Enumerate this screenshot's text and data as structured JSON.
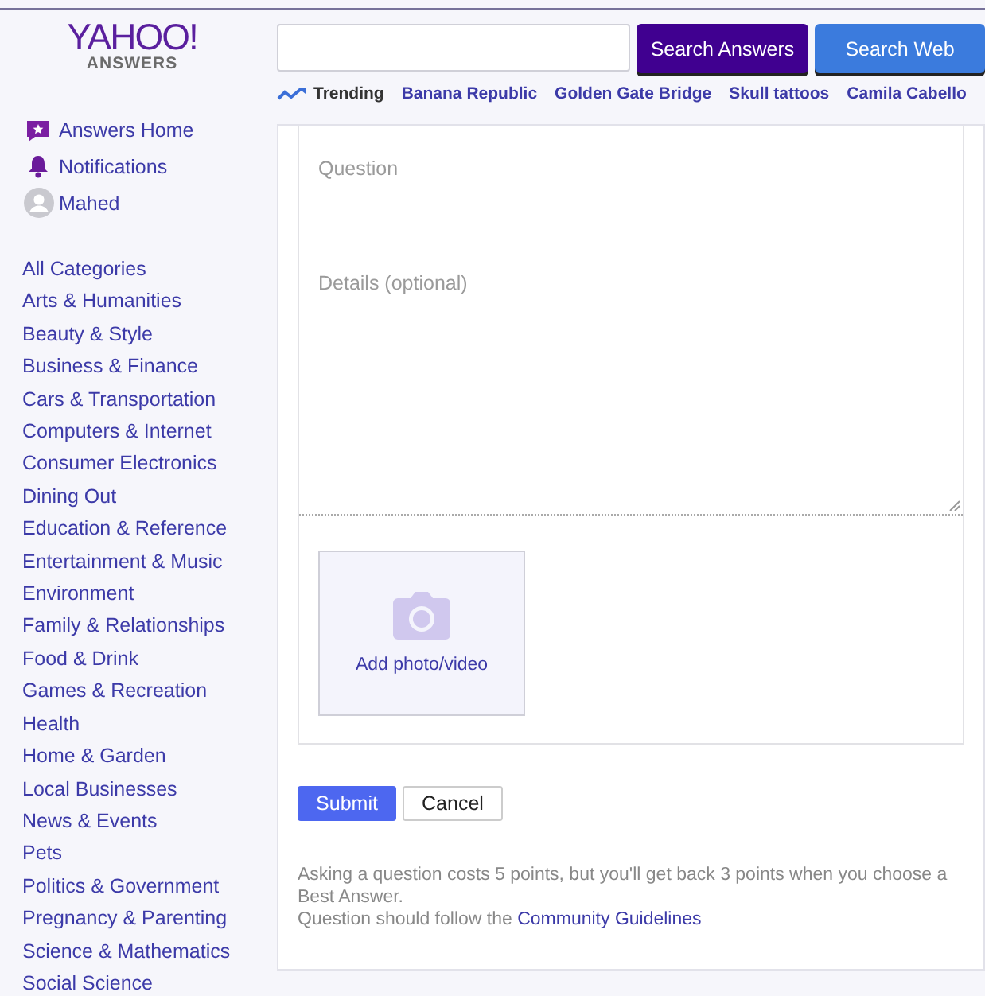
{
  "logo": {
    "brand": "YAHOO!",
    "product": "ANSWERS"
  },
  "nav": [
    {
      "kind": "home",
      "label": "Answers Home"
    },
    {
      "kind": "bell",
      "label": "Notifications"
    },
    {
      "kind": "avatar",
      "label": "Mahed"
    }
  ],
  "categories": [
    "All Categories",
    "Arts & Humanities",
    "Beauty & Style",
    "Business & Finance",
    "Cars & Transportation",
    "Computers & Internet",
    "Consumer Electronics",
    "Dining Out",
    "Education & Reference",
    "Entertainment & Music",
    "Environment",
    "Family & Relationships",
    "Food & Drink",
    "Games & Recreation",
    "Health",
    "Home & Garden",
    "Local Businesses",
    "News & Events",
    "Pets",
    "Politics & Government",
    "Pregnancy & Parenting",
    "Science & Mathematics",
    "Social Science"
  ],
  "search": {
    "buttons": [
      {
        "kind": "answers",
        "label": "Search Answers"
      },
      {
        "kind": "web",
        "label": "Search Web"
      }
    ]
  },
  "trending": {
    "label": "Trending",
    "topics": [
      "Banana Republic",
      "Golden Gate Bridge",
      "Skull tattoos",
      "Camila Cabello"
    ]
  },
  "form": {
    "question_placeholder": "Question",
    "details_placeholder": "Details (optional)",
    "add_media": "Add photo/video",
    "buttons": [
      {
        "kind": "primary",
        "label": "Submit"
      },
      {
        "kind": "secondary",
        "label": "Cancel"
      }
    ],
    "note": "Asking a question costs 5 points, but you'll get back 3 points when you choose a Best Answer.",
    "rules_text": "Question should follow the",
    "rules_link": "Community Guidelines"
  }
}
